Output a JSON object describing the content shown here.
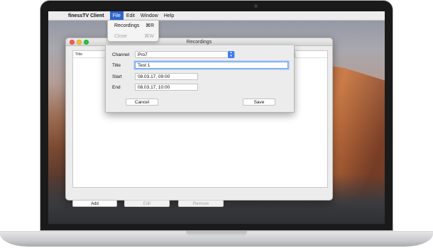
{
  "menubar": {
    "apple": "",
    "app_name": "finessTV Client",
    "items": [
      "File",
      "Edit",
      "Window",
      "Help"
    ]
  },
  "file_menu": {
    "items": [
      {
        "label": "Recordings",
        "shortcut": "⌘R",
        "enabled": true
      },
      {
        "label": "Close",
        "shortcut": "⌘W",
        "enabled": false
      }
    ]
  },
  "window": {
    "title": "Recordings",
    "table": {
      "columns": [
        "Title"
      ]
    },
    "buttons": {
      "add": "Add",
      "edit": "Edit",
      "remove": "Remove"
    }
  },
  "sheet": {
    "channel_label": "Channel",
    "channel_value": "Pro7",
    "title_label": "Title",
    "title_value": "Test 1",
    "start_label": "Start",
    "start_value": "08.03.17, 09:00",
    "end_label": "End",
    "end_value": "08.03.17, 10:00",
    "cancel": "Cancel",
    "save": "Save"
  },
  "colors": {
    "accent": "#2f66d1",
    "focus_ring": "#6fa3ee"
  }
}
